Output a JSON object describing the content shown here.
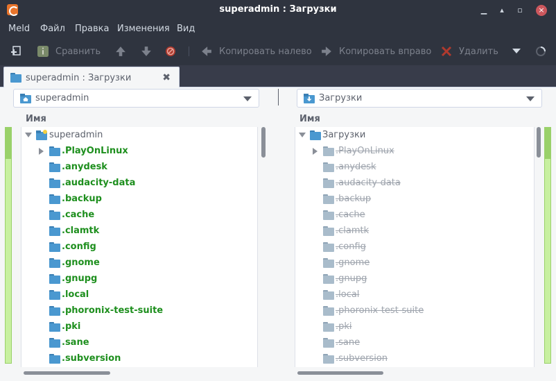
{
  "window": {
    "title": "superadmin : Загрузки"
  },
  "menubar": {
    "items": [
      "Meld",
      "Файл",
      "Правка",
      "Изменения",
      "Вид"
    ]
  },
  "toolbar": {
    "compare_label": "Сравнить",
    "copy_left_label": "Копировать налево",
    "copy_right_label": "Копировать вправо",
    "delete_label": "Удалить"
  },
  "tab": {
    "label": "superadmin : Загрузки"
  },
  "left_pane": {
    "location": "superadmin",
    "column_header": "Имя",
    "root_label": "superadmin",
    "items": [
      ".PlayOnLinux",
      ".anydesk",
      ".audacity-data",
      ".backup",
      ".cache",
      ".clamtk",
      ".config",
      ".gnome",
      ".gnupg",
      ".local",
      ".phoronix-test-suite",
      ".pki",
      ".sane",
      ".subversion"
    ]
  },
  "right_pane": {
    "location": "Загрузки",
    "column_header": "Имя",
    "root_label": "Загрузки",
    "items": [
      ".PlayOnLinux",
      ".anydesk",
      ".audacity-data",
      ".backup",
      ".cache",
      ".clamtk",
      ".config",
      ".gnome",
      ".gnupg",
      ".local",
      ".phoronix-test-suite",
      ".pki",
      ".sane",
      ".subversion"
    ]
  },
  "colors": {
    "new_item": "#1e8f1e",
    "missing_item": "#9ea4ad",
    "gutter": "#c8f0a0"
  }
}
